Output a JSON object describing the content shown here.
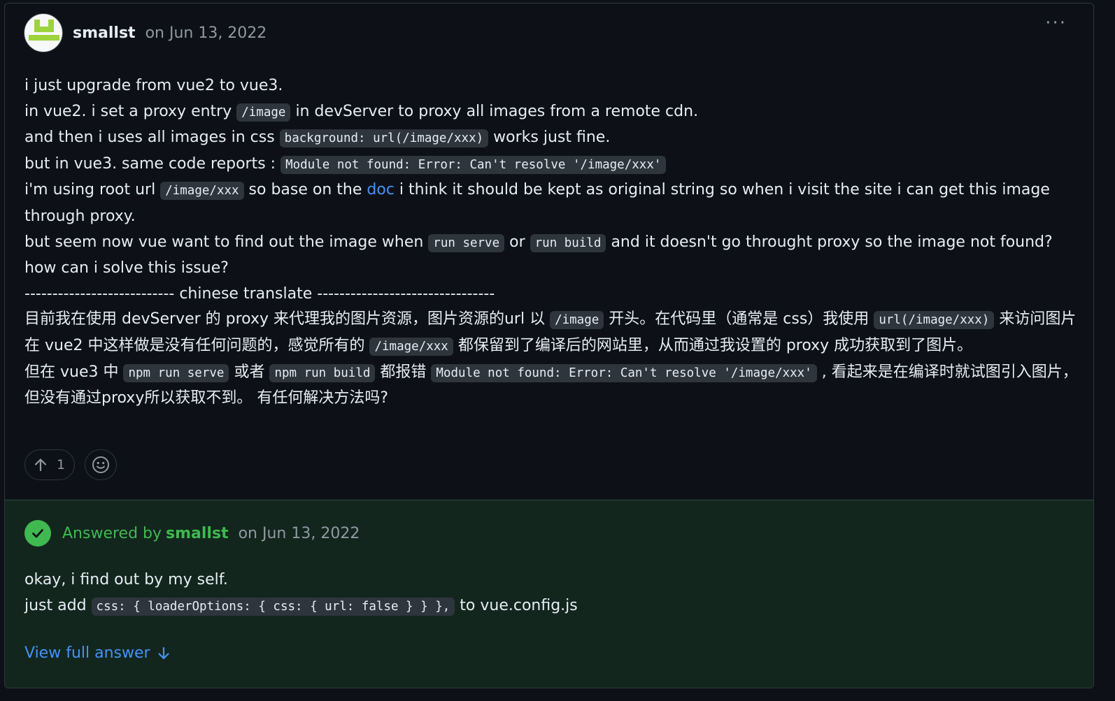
{
  "post": {
    "author": "smallst",
    "date": "on Jun 13, 2022",
    "more_icon": "kebab-horizontal-icon",
    "line1": "i just upgrade from vue2 to vue3.",
    "line2_a": "in vue2. i set a proxy entry ",
    "line2_code": "/image",
    "line2_b": " in devServer to proxy all images from a remote cdn.",
    "line3_a": "and then i uses all images in css ",
    "line3_code": "background: url(/image/xxx)",
    "line3_b": " works just fine.",
    "line4_a": "but in vue3. same code reports : ",
    "line4_code": "Module not found: Error: Can't resolve '/image/xxx'",
    "line5_a": "i'm using root url ",
    "line5_code": "/image/xxx",
    "line5_b": " so base on the ",
    "line5_link": "doc",
    "line5_c": " i think it should be kept as original string so when i visit the site i can get this image through proxy.",
    "line6_a": "but seem now vue want to find out the image when ",
    "line6_code1": "run serve",
    "line6_b": " or ",
    "line6_code2": "run build",
    "line6_c": " and it doesn't go throught proxy so the image not found?",
    "line7": "how can i solve this issue?",
    "line8": "--------------------------- chinese translate --------------------------------",
    "zh1_a": "目前我在使用 devServer 的 proxy 来代理我的图片资源，图片资源的url 以 ",
    "zh1_code1": "/image",
    "zh1_b": " 开头。在代码里（通常是 css）我使用 ",
    "zh1_code2": "url(/image/xxx)",
    "zh1_c": " 来访问图片",
    "zh2_a": "在 vue2 中这样做是没有任何问题的，感觉所有的 ",
    "zh2_code": "/image/xxx",
    "zh2_b": " 都保留到了编译后的网站里，从而通过我设置的 proxy 成功获取到了图片。",
    "zh3_a": "但在 vue3 中 ",
    "zh3_code1": "npm run serve",
    "zh3_b": " 或者 ",
    "zh3_code2": "npm run build",
    "zh3_c": " 都报错 ",
    "zh3_code3": "Module not found: Error: Can't resolve '/image/xxx'",
    "zh3_d": " , 看起来是在编译时就试图引入图片，但没有通过proxy所以获取不到。 有任何解决方法吗?"
  },
  "reactions": {
    "upvote_icon": "arrow-up-icon",
    "upvote_count": "1",
    "emoji_icon": "smiley-icon"
  },
  "answer": {
    "answered_label": "Answered by",
    "answerer": "smallst",
    "date": "on Jun 13, 2022",
    "line1": "okay, i find out by my self.",
    "line2_a": "just add ",
    "line2_code": "css: { loaderOptions: { css: { url: false } } },",
    "line2_b": " to vue.config.js",
    "view_full": "View full answer"
  },
  "colors": {
    "background": "#0d1117",
    "answer_bg": "#12261e",
    "accent_green": "#3fb950",
    "link_blue": "#4493f8",
    "muted": "#9198a1"
  }
}
